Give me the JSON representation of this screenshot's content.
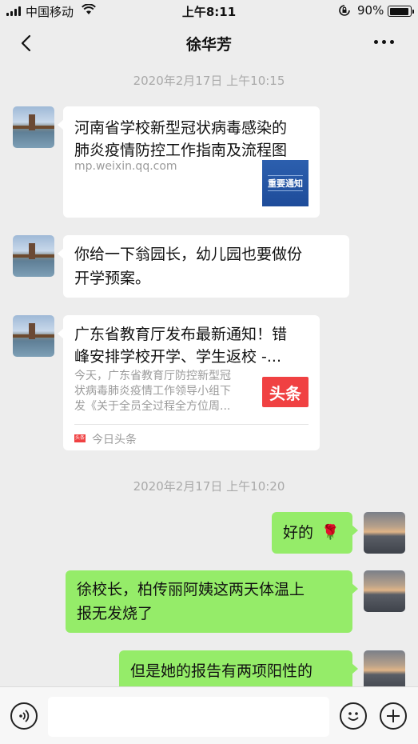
{
  "status": {
    "carrier": "中国移动",
    "time": "上午8:11",
    "battery": "90%"
  },
  "header": {
    "title": "徐华芳"
  },
  "timestamps": [
    "2020年2月17日 上午10:15",
    "2020年2月17日 上午10:20"
  ],
  "messages": {
    "m1": {
      "title_line1": "河南省学校新型冠状病毒感染的",
      "title_line2": "肺炎疫情防控工作指南及流程图",
      "source": "mp.weixin.qq.com",
      "thumb_text": "重要通知"
    },
    "m2": {
      "line1": "你给一下翁园长，幼儿园也要做份",
      "line2": "开学预案。"
    },
    "m3": {
      "title_line1": "广东省教育厅发布最新通知！错",
      "title_line2": "峰安排学校开学、学生返校 -...",
      "desc_line1": "今天，广东省教育厅防控新型冠",
      "desc_line2": "状病毒肺炎疫情工作领导小组下",
      "desc_line3": "发《关于全员全过程全方位周...",
      "thumb_text": "头条",
      "source_icon": "头条",
      "source": "今日头条"
    },
    "m4": {
      "text": "好的",
      "emoji": "🌹"
    },
    "m5": {
      "line1": "徐校长，柏传丽阿姨这两天体温上",
      "line2": "报无发烧了"
    },
    "m6": {
      "text": "但是她的报告有两项阳性的"
    }
  },
  "colors": {
    "background": "#ededed",
    "bubble_self": "#95ec69",
    "bubble_other": "#ffffff",
    "toutiao_red": "#f04142"
  }
}
